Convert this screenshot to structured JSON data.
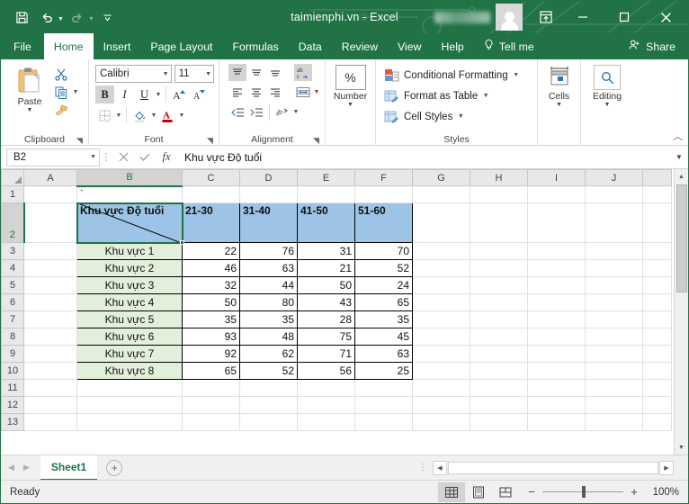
{
  "window": {
    "title": "taimienphi.vn  -  Excel",
    "quick_access": [
      "save-icon",
      "undo-icon",
      "redo-icon",
      "customize-icon"
    ],
    "ribbon_display_options": "ribbon-display-options-icon",
    "minimize": "minimize-icon",
    "maximize": "maximize-icon",
    "close": "close-icon",
    "account_name_blurred": ""
  },
  "tabs": {
    "items": [
      {
        "label": "File",
        "active": false
      },
      {
        "label": "Home",
        "active": true
      },
      {
        "label": "Insert",
        "active": false
      },
      {
        "label": "Page Layout",
        "active": false
      },
      {
        "label": "Formulas",
        "active": false
      },
      {
        "label": "Data",
        "active": false
      },
      {
        "label": "Review",
        "active": false
      },
      {
        "label": "View",
        "active": false
      },
      {
        "label": "Help",
        "active": false
      }
    ],
    "tell_me": "Tell me",
    "share": "Share"
  },
  "ribbon": {
    "groups": [
      {
        "name": "Clipboard",
        "label": "Clipboard"
      },
      {
        "name": "Font",
        "label": "Font"
      },
      {
        "name": "Alignment",
        "label": "Alignment"
      },
      {
        "name": "Number",
        "label": "Number"
      },
      {
        "name": "Styles",
        "label": "Styles"
      },
      {
        "name": "Cells",
        "label": "Cells"
      },
      {
        "name": "Editing",
        "label": "Editing"
      }
    ],
    "clipboard": {
      "paste_label": "Paste"
    },
    "font": {
      "font_name": "Calibri",
      "font_size": "11",
      "bold": "B",
      "italic": "I",
      "underline": "U",
      "bold_active": true
    },
    "number": {
      "label": "Number",
      "format_icon": "percent-icon"
    },
    "styles": {
      "conditional_formatting": "Conditional Formatting",
      "format_as_table": "Format as Table",
      "cell_styles": "Cell Styles"
    },
    "cells": {
      "label": "Cells"
    },
    "editing": {
      "label": "Editing"
    }
  },
  "formula_bar": {
    "name_box": "B2",
    "cancel": "cancel-icon",
    "enter": "enter-icon",
    "fx": "fx",
    "formula_value": "Khu vực Độ tuổi"
  },
  "grid": {
    "columns": [
      "A",
      "B",
      "C",
      "D",
      "E",
      "F",
      "G",
      "H",
      "I",
      "J",
      ""
    ],
    "selected_column": "B",
    "selected_row": "2",
    "rows": [
      "1",
      "2",
      "3",
      "4",
      "5",
      "6",
      "7",
      "8",
      "9",
      "10",
      "11",
      "12",
      "13"
    ],
    "active_cell": "B2",
    "cells": {
      "B1": "`",
      "B2": "Khu vực Độ tuổi",
      "C2": "21-30",
      "D2": "31-40",
      "E2": "41-50",
      "F2": "51-60"
    },
    "table": {
      "header_row_label": "Khu vực Độ tuổi",
      "age_columns": [
        "21-30",
        "31-40",
        "41-50",
        "51-60"
      ],
      "rows": [
        {
          "region": "Khu vực 1",
          "values": [
            22,
            76,
            31,
            70
          ]
        },
        {
          "region": "Khu vực 2",
          "values": [
            46,
            63,
            21,
            52
          ]
        },
        {
          "region": "Khu vực 3",
          "values": [
            32,
            44,
            50,
            24
          ]
        },
        {
          "region": "Khu vực 4",
          "values": [
            50,
            80,
            43,
            65
          ]
        },
        {
          "region": "Khu vực 5",
          "values": [
            35,
            35,
            28,
            35
          ]
        },
        {
          "region": "Khu vực 6",
          "values": [
            93,
            48,
            75,
            45
          ]
        },
        {
          "region": "Khu vực 7",
          "values": [
            92,
            62,
            71,
            63
          ]
        },
        {
          "region": "Khu vực 8",
          "values": [
            65,
            52,
            56,
            25
          ]
        }
      ]
    },
    "colors": {
      "header_fill": "#9dc3e6",
      "region_fill": "#e2efda",
      "selection": "#217346"
    }
  },
  "sheet_bar": {
    "sheets": [
      {
        "name": "Sheet1",
        "active": true
      }
    ],
    "add_sheet": "+"
  },
  "status_bar": {
    "status": "Ready",
    "views": [
      "normal-view-icon",
      "page-layout-view-icon",
      "page-break-view-icon"
    ],
    "active_view": "normal-view-icon",
    "zoom_out": "−",
    "zoom_in": "+",
    "zoom_level": "100%"
  }
}
